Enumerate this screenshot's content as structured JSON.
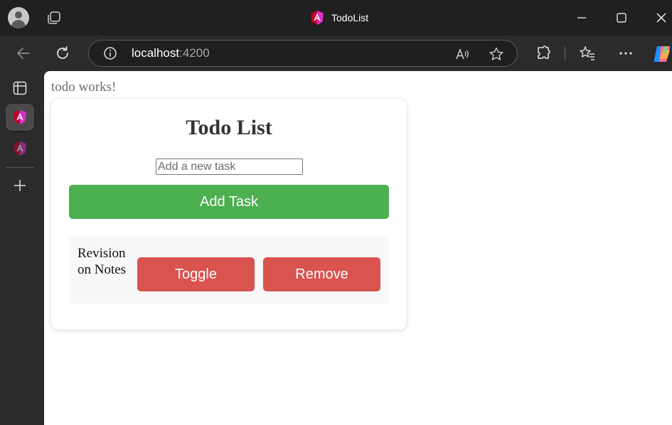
{
  "window": {
    "title": "TodoList"
  },
  "address_bar": {
    "host": "localhost",
    "port": ":4200"
  },
  "page": {
    "works_text": "todo works!",
    "heading": "Todo List",
    "input_placeholder": "Add a new task",
    "input_value": "",
    "add_button_label": "Add Task",
    "tasks": [
      {
        "text": "Revision on Notes",
        "toggle_label": "Toggle",
        "remove_label": "Remove"
      }
    ]
  },
  "colors": {
    "add_button": "#4caf50",
    "task_buttons": "#d9534f",
    "angular_logo": "#c3002f",
    "angular_logo_accent": "#e040fb"
  },
  "icons": {
    "titlebar": [
      "profile-avatar-icon",
      "tab-actions-icon",
      "angular-logo-icon",
      "minimize-icon",
      "maximize-icon",
      "close-icon"
    ],
    "toolbar": [
      "back-icon",
      "refresh-icon",
      "site-info-icon",
      "read-aloud-icon",
      "favorite-star-icon",
      "extensions-icon",
      "favorites-icon",
      "more-icon",
      "copilot-icon"
    ],
    "sidebar": [
      "vertical-tabs-icon",
      "angular-tab-icon",
      "angular-tab-icon",
      "new-tab-plus-icon"
    ]
  }
}
